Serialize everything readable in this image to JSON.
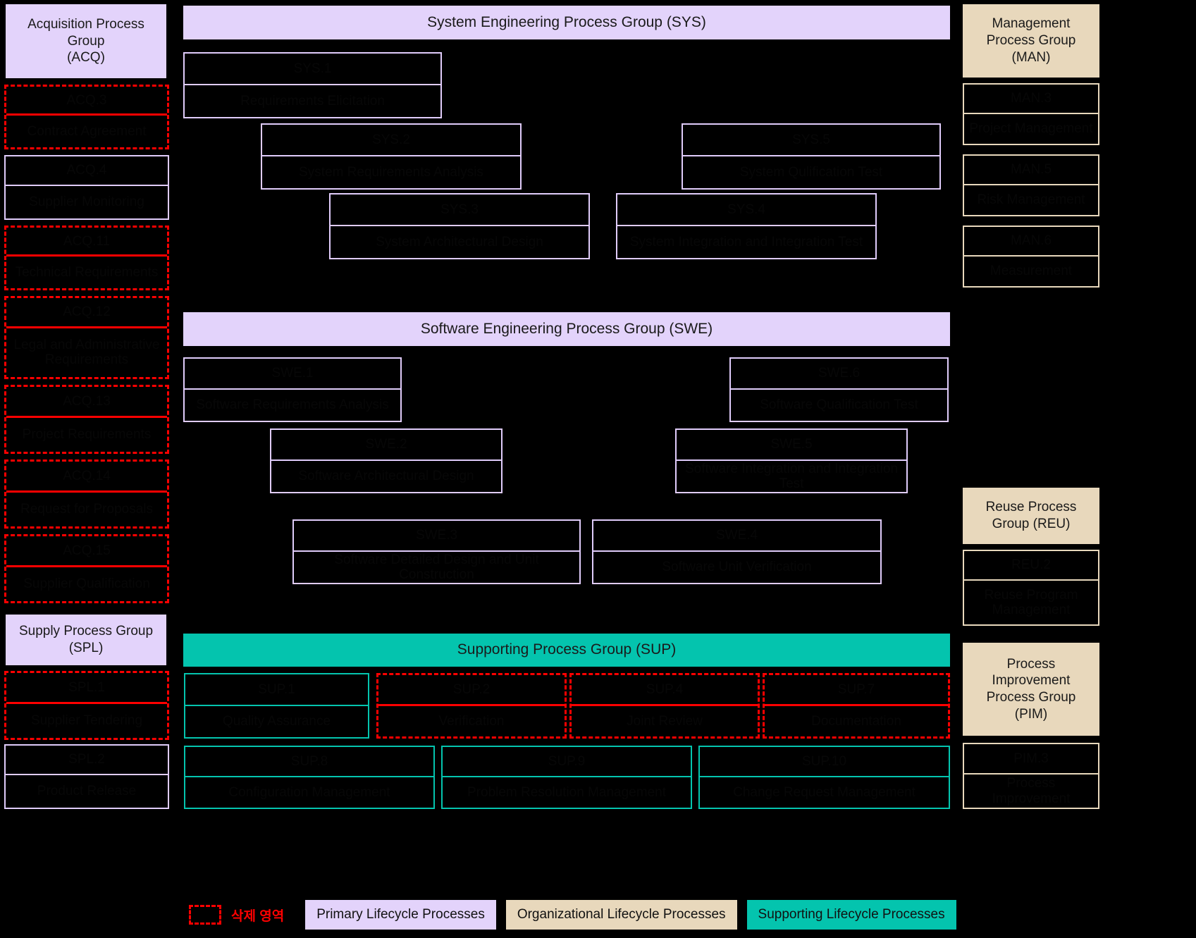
{
  "groups": {
    "acq": {
      "title": "Acquisition Process\nGroup\n(ACQ)"
    },
    "spl": {
      "title": "Supply Process Group\n(SPL)"
    },
    "sys": {
      "title": "System Engineering Process Group (SYS)"
    },
    "swe": {
      "title": "Software Engineering Process Group (SWE)"
    },
    "sup": {
      "title": "Supporting Process Group (SUP)"
    },
    "man": {
      "title": "Management\nProcess Group\n(MAN)"
    },
    "reu": {
      "title": "Reuse Process\nGroup (REU)"
    },
    "pim": {
      "title": "Process\nImprovement\nProcess Group\n(PIM)"
    }
  },
  "acq_items": [
    {
      "id": "ACQ.3",
      "name": "Contract Agreement",
      "style": "deleted"
    },
    {
      "id": "ACQ.4",
      "name": "Supplier Monitoring",
      "style": "purple"
    },
    {
      "id": "ACQ.11",
      "name": "Technical Requirements",
      "style": "deleted"
    },
    {
      "id": "ACQ.12",
      "name": "Legal and Administrative Requirements",
      "style": "deleted"
    },
    {
      "id": "ACQ.13",
      "name": "Project Requirements",
      "style": "deleted"
    },
    {
      "id": "ACQ.14",
      "name": "Request for Proposals",
      "style": "deleted"
    },
    {
      "id": "ACQ.15",
      "name": "Supplier Qualification",
      "style": "deleted"
    }
  ],
  "spl_items": [
    {
      "id": "SPL.1",
      "name": "Supplier Tendering",
      "style": "deleted"
    },
    {
      "id": "SPL.2",
      "name": "Product Release",
      "style": "purple"
    }
  ],
  "sys_items": [
    {
      "id": "SYS.1",
      "name": "Requirements Elicitation",
      "style": "purple"
    },
    {
      "id": "SYS.2",
      "name": "System Requirements Analysis",
      "style": "purple"
    },
    {
      "id": "SYS.5",
      "name": "System Qulification Test",
      "style": "purple"
    },
    {
      "id": "SYS.3",
      "name": "System Architectural Design",
      "style": "purple"
    },
    {
      "id": "SYS.4",
      "name": "System Integration and Integration Test",
      "style": "purple"
    }
  ],
  "swe_items": [
    {
      "id": "SWE.1",
      "name": "Software Requirements Analysis",
      "style": "purple"
    },
    {
      "id": "SWE.6",
      "name": "Software Qualification Test",
      "style": "purple"
    },
    {
      "id": "SWE.2",
      "name": "Software Architectural Design",
      "style": "purple"
    },
    {
      "id": "SWE.5",
      "name": "Software Integration and Integration Test",
      "style": "purple"
    },
    {
      "id": "SWE.3",
      "name": "Software Detailed Design and Unit Construction",
      "style": "purple"
    },
    {
      "id": "SWE.4",
      "name": "Software Unit Verification",
      "style": "purple"
    }
  ],
  "sup_items_row1": [
    {
      "id": "SUP.1",
      "name": "Quality Assurance",
      "style": "teal"
    },
    {
      "id": "SUP.2",
      "name": "Verification",
      "style": "deleted"
    },
    {
      "id": "SUP.4",
      "name": "Joint Review",
      "style": "deleted"
    },
    {
      "id": "SUP.7",
      "name": "Documentation",
      "style": "deleted"
    }
  ],
  "sup_items_row2": [
    {
      "id": "SUP.8",
      "name": "Configuration Management",
      "style": "teal"
    },
    {
      "id": "SUP.9",
      "name": "Problem Resolution Management",
      "style": "teal"
    },
    {
      "id": "SUP.10",
      "name": "Change Request Management",
      "style": "teal"
    }
  ],
  "man_items": [
    {
      "id": "MAN.3",
      "name": "Project Management",
      "style": "tan"
    },
    {
      "id": "MAN.5",
      "name": "Risk Management",
      "style": "tan"
    },
    {
      "id": "MAN.6",
      "name": "Measurement",
      "style": "tan"
    }
  ],
  "reu_items": [
    {
      "id": "REU.2",
      "name": "Reuse Program Management",
      "style": "tan"
    }
  ],
  "pim_items": [
    {
      "id": "PIM.3",
      "name": "Process Improvement",
      "style": "tan"
    }
  ],
  "legend": {
    "deleted_label": "삭제 영역",
    "primary": "Primary Lifecycle Processes",
    "organizational": "Organizational Lifecycle Processes",
    "supporting": "Supporting Lifecycle Processes"
  }
}
